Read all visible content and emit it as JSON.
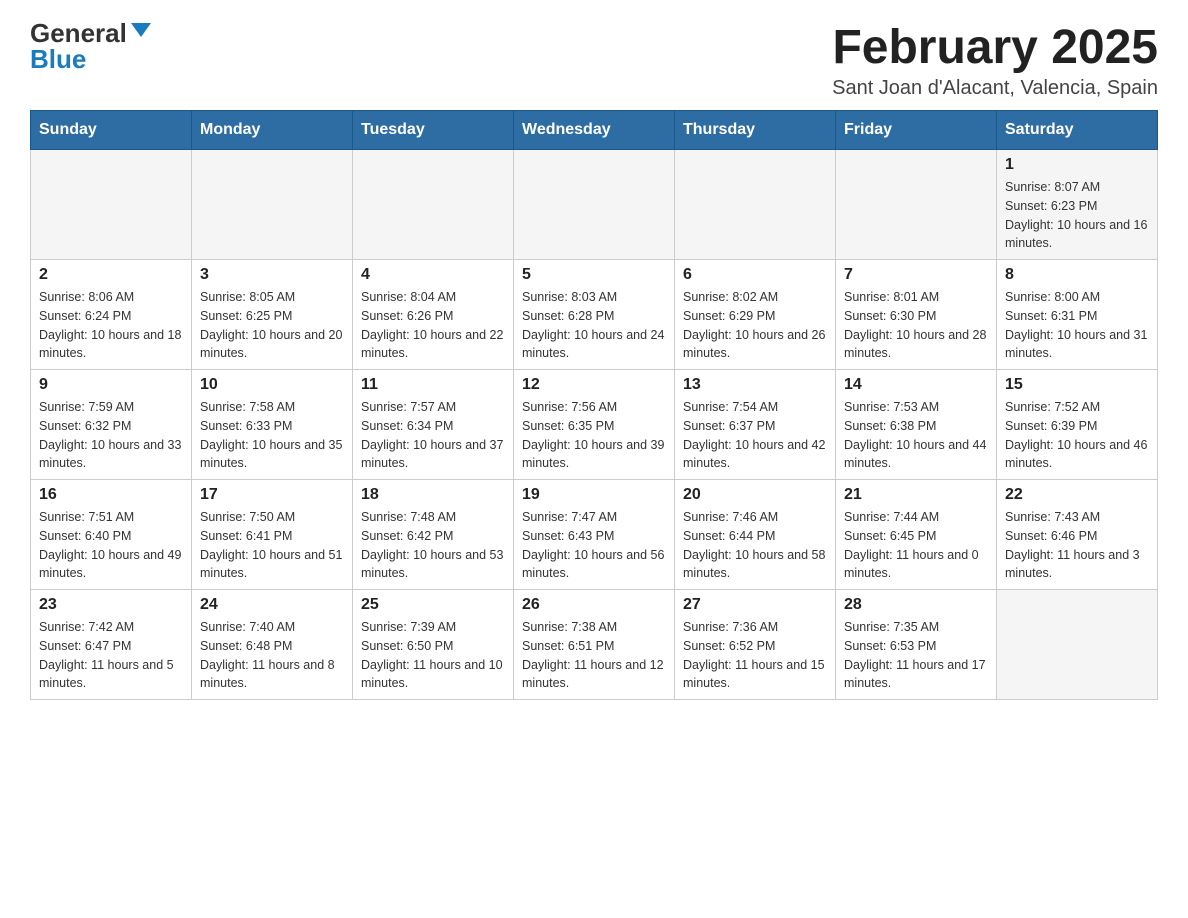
{
  "header": {
    "logo_general": "General",
    "logo_blue": "Blue",
    "month_title": "February 2025",
    "location": "Sant Joan d'Alacant, Valencia, Spain"
  },
  "days_of_week": [
    "Sunday",
    "Monday",
    "Tuesday",
    "Wednesday",
    "Thursday",
    "Friday",
    "Saturday"
  ],
  "weeks": [
    [
      {
        "day": "",
        "sunrise": "",
        "sunset": "",
        "daylight": ""
      },
      {
        "day": "",
        "sunrise": "",
        "sunset": "",
        "daylight": ""
      },
      {
        "day": "",
        "sunrise": "",
        "sunset": "",
        "daylight": ""
      },
      {
        "day": "",
        "sunrise": "",
        "sunset": "",
        "daylight": ""
      },
      {
        "day": "",
        "sunrise": "",
        "sunset": "",
        "daylight": ""
      },
      {
        "day": "",
        "sunrise": "",
        "sunset": "",
        "daylight": ""
      },
      {
        "day": "1",
        "sunrise": "Sunrise: 8:07 AM",
        "sunset": "Sunset: 6:23 PM",
        "daylight": "Daylight: 10 hours and 16 minutes."
      }
    ],
    [
      {
        "day": "2",
        "sunrise": "Sunrise: 8:06 AM",
        "sunset": "Sunset: 6:24 PM",
        "daylight": "Daylight: 10 hours and 18 minutes."
      },
      {
        "day": "3",
        "sunrise": "Sunrise: 8:05 AM",
        "sunset": "Sunset: 6:25 PM",
        "daylight": "Daylight: 10 hours and 20 minutes."
      },
      {
        "day": "4",
        "sunrise": "Sunrise: 8:04 AM",
        "sunset": "Sunset: 6:26 PM",
        "daylight": "Daylight: 10 hours and 22 minutes."
      },
      {
        "day": "5",
        "sunrise": "Sunrise: 8:03 AM",
        "sunset": "Sunset: 6:28 PM",
        "daylight": "Daylight: 10 hours and 24 minutes."
      },
      {
        "day": "6",
        "sunrise": "Sunrise: 8:02 AM",
        "sunset": "Sunset: 6:29 PM",
        "daylight": "Daylight: 10 hours and 26 minutes."
      },
      {
        "day": "7",
        "sunrise": "Sunrise: 8:01 AM",
        "sunset": "Sunset: 6:30 PM",
        "daylight": "Daylight: 10 hours and 28 minutes."
      },
      {
        "day": "8",
        "sunrise": "Sunrise: 8:00 AM",
        "sunset": "Sunset: 6:31 PM",
        "daylight": "Daylight: 10 hours and 31 minutes."
      }
    ],
    [
      {
        "day": "9",
        "sunrise": "Sunrise: 7:59 AM",
        "sunset": "Sunset: 6:32 PM",
        "daylight": "Daylight: 10 hours and 33 minutes."
      },
      {
        "day": "10",
        "sunrise": "Sunrise: 7:58 AM",
        "sunset": "Sunset: 6:33 PM",
        "daylight": "Daylight: 10 hours and 35 minutes."
      },
      {
        "day": "11",
        "sunrise": "Sunrise: 7:57 AM",
        "sunset": "Sunset: 6:34 PM",
        "daylight": "Daylight: 10 hours and 37 minutes."
      },
      {
        "day": "12",
        "sunrise": "Sunrise: 7:56 AM",
        "sunset": "Sunset: 6:35 PM",
        "daylight": "Daylight: 10 hours and 39 minutes."
      },
      {
        "day": "13",
        "sunrise": "Sunrise: 7:54 AM",
        "sunset": "Sunset: 6:37 PM",
        "daylight": "Daylight: 10 hours and 42 minutes."
      },
      {
        "day": "14",
        "sunrise": "Sunrise: 7:53 AM",
        "sunset": "Sunset: 6:38 PM",
        "daylight": "Daylight: 10 hours and 44 minutes."
      },
      {
        "day": "15",
        "sunrise": "Sunrise: 7:52 AM",
        "sunset": "Sunset: 6:39 PM",
        "daylight": "Daylight: 10 hours and 46 minutes."
      }
    ],
    [
      {
        "day": "16",
        "sunrise": "Sunrise: 7:51 AM",
        "sunset": "Sunset: 6:40 PM",
        "daylight": "Daylight: 10 hours and 49 minutes."
      },
      {
        "day": "17",
        "sunrise": "Sunrise: 7:50 AM",
        "sunset": "Sunset: 6:41 PM",
        "daylight": "Daylight: 10 hours and 51 minutes."
      },
      {
        "day": "18",
        "sunrise": "Sunrise: 7:48 AM",
        "sunset": "Sunset: 6:42 PM",
        "daylight": "Daylight: 10 hours and 53 minutes."
      },
      {
        "day": "19",
        "sunrise": "Sunrise: 7:47 AM",
        "sunset": "Sunset: 6:43 PM",
        "daylight": "Daylight: 10 hours and 56 minutes."
      },
      {
        "day": "20",
        "sunrise": "Sunrise: 7:46 AM",
        "sunset": "Sunset: 6:44 PM",
        "daylight": "Daylight: 10 hours and 58 minutes."
      },
      {
        "day": "21",
        "sunrise": "Sunrise: 7:44 AM",
        "sunset": "Sunset: 6:45 PM",
        "daylight": "Daylight: 11 hours and 0 minutes."
      },
      {
        "day": "22",
        "sunrise": "Sunrise: 7:43 AM",
        "sunset": "Sunset: 6:46 PM",
        "daylight": "Daylight: 11 hours and 3 minutes."
      }
    ],
    [
      {
        "day": "23",
        "sunrise": "Sunrise: 7:42 AM",
        "sunset": "Sunset: 6:47 PM",
        "daylight": "Daylight: 11 hours and 5 minutes."
      },
      {
        "day": "24",
        "sunrise": "Sunrise: 7:40 AM",
        "sunset": "Sunset: 6:48 PM",
        "daylight": "Daylight: 11 hours and 8 minutes."
      },
      {
        "day": "25",
        "sunrise": "Sunrise: 7:39 AM",
        "sunset": "Sunset: 6:50 PM",
        "daylight": "Daylight: 11 hours and 10 minutes."
      },
      {
        "day": "26",
        "sunrise": "Sunrise: 7:38 AM",
        "sunset": "Sunset: 6:51 PM",
        "daylight": "Daylight: 11 hours and 12 minutes."
      },
      {
        "day": "27",
        "sunrise": "Sunrise: 7:36 AM",
        "sunset": "Sunset: 6:52 PM",
        "daylight": "Daylight: 11 hours and 15 minutes."
      },
      {
        "day": "28",
        "sunrise": "Sunrise: 7:35 AM",
        "sunset": "Sunset: 6:53 PM",
        "daylight": "Daylight: 11 hours and 17 minutes."
      },
      {
        "day": "",
        "sunrise": "",
        "sunset": "",
        "daylight": ""
      }
    ]
  ]
}
